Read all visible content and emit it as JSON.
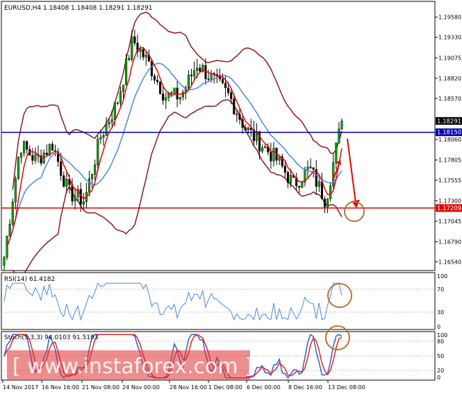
{
  "header": {
    "symbol_label": "EURUSD,H4  1.18408 1.18408 1.18291 1.18291"
  },
  "price_axis": {
    "ticks": [
      "1.19580",
      "1.19330",
      "1.19075",
      "1.18820",
      "1.18570",
      "1.18060",
      "1.17805",
      "1.17555",
      "1.17300",
      "1.17045",
      "1.16790",
      "1.16540"
    ],
    "tick_values": [
      1.1958,
      1.1933,
      1.19075,
      1.1882,
      1.1857,
      1.1806,
      1.17805,
      1.17555,
      1.173,
      1.17045,
      1.1679,
      1.1654
    ],
    "ylim": [
      1.1645,
      1.1975
    ]
  },
  "levels": {
    "current": {
      "label": "1.18291",
      "value": 1.18291
    },
    "resistance": {
      "label": "1.18150",
      "value": 1.1815,
      "color": "#0000aa"
    },
    "support": {
      "label": "1.17209",
      "value": 1.17209,
      "color": "#dd0000"
    }
  },
  "rsi_panel": {
    "label": "RSI(14) 61.4182",
    "ticks": [
      "100",
      "70",
      "30",
      "0"
    ],
    "color": "#4a86e8"
  },
  "stoch_panel": {
    "label": "Stoch(5,3,3) 94.0103 91.5193",
    "ticks": [
      "100",
      "80",
      "50",
      "20",
      "0"
    ],
    "main_color": "#2b60d8",
    "signal_color": "#ee2020"
  },
  "watermark": {
    "text": "[ www.instaforex.com ]"
  },
  "time_axis": {
    "labels": [
      "14 Nov 2017",
      "16 Nov 16:00",
      "21 Nov 08:00",
      "24 Nov 00:00",
      "28 Nov 16:00",
      "1 Dec 08:00",
      "6 Dec 00:00",
      "8 Dec 16:00",
      "13 Dec 08:00"
    ]
  },
  "colors": {
    "bull_candle": "#00aa00",
    "bear_candle": "#000000",
    "bollinger": "#8b1a1a",
    "fast_ma": "#ee0000",
    "slow_ma": "#4a86e8",
    "annotation": "#b87333",
    "arrow": "#ee0000"
  },
  "chart_data": {
    "type": "candlestick",
    "instrument": "EURUSD",
    "timeframe": "H4",
    "ohlc_last": {
      "open": 1.18408,
      "high": 1.18408,
      "low": 1.18291,
      "close": 1.18291
    },
    "close_path": [
      {
        "date": "14 Nov 2017",
        "close": 1.166
      },
      {
        "date": "15 Nov 2017",
        "close": 1.18
      },
      {
        "date": "16 Nov 2017",
        "close": 1.178
      },
      {
        "date": "17 Nov 2017",
        "close": 1.18
      },
      {
        "date": "20 Nov 2017",
        "close": 1.174
      },
      {
        "date": "21 Nov 2017",
        "close": 1.173
      },
      {
        "date": "22 Nov 2017",
        "close": 1.181
      },
      {
        "date": "23 Nov 2017",
        "close": 1.185
      },
      {
        "date": "24 Nov 2017",
        "close": 1.193
      },
      {
        "date": "27 Nov 2017",
        "close": 1.19
      },
      {
        "date": "28 Nov 2017",
        "close": 1.186
      },
      {
        "date": "29 Nov 2017",
        "close": 1.186
      },
      {
        "date": "30 Nov 2017",
        "close": 1.19
      },
      {
        "date": "1 Dec 2017",
        "close": 1.188
      },
      {
        "date": "4 Dec 2017",
        "close": 1.186
      },
      {
        "date": "5 Dec 2017",
        "close": 1.182
      },
      {
        "date": "6 Dec 2017",
        "close": 1.18
      },
      {
        "date": "7 Dec 2017",
        "close": 1.178
      },
      {
        "date": "8 Dec 2017",
        "close": 1.175
      },
      {
        "date": "11 Dec 2017",
        "close": 1.177
      },
      {
        "date": "12 Dec 2017",
        "close": 1.173
      },
      {
        "date": "13 Dec 2017",
        "close": 1.18291
      }
    ],
    "horizontal_lines": [
      {
        "value": 1.1815,
        "color": "#0000aa"
      },
      {
        "value": 1.17209,
        "color": "#dd0000"
      }
    ],
    "indicators": {
      "rsi": {
        "period": 14,
        "value": 61.4182,
        "levels": [
          70,
          30
        ],
        "range": [
          0,
          100
        ]
      },
      "stochastic": {
        "params": "5,3,3",
        "main": 94.0103,
        "signal": 91.5193,
        "levels": [
          80,
          50,
          20
        ],
        "range": [
          0,
          100
        ]
      }
    }
  }
}
